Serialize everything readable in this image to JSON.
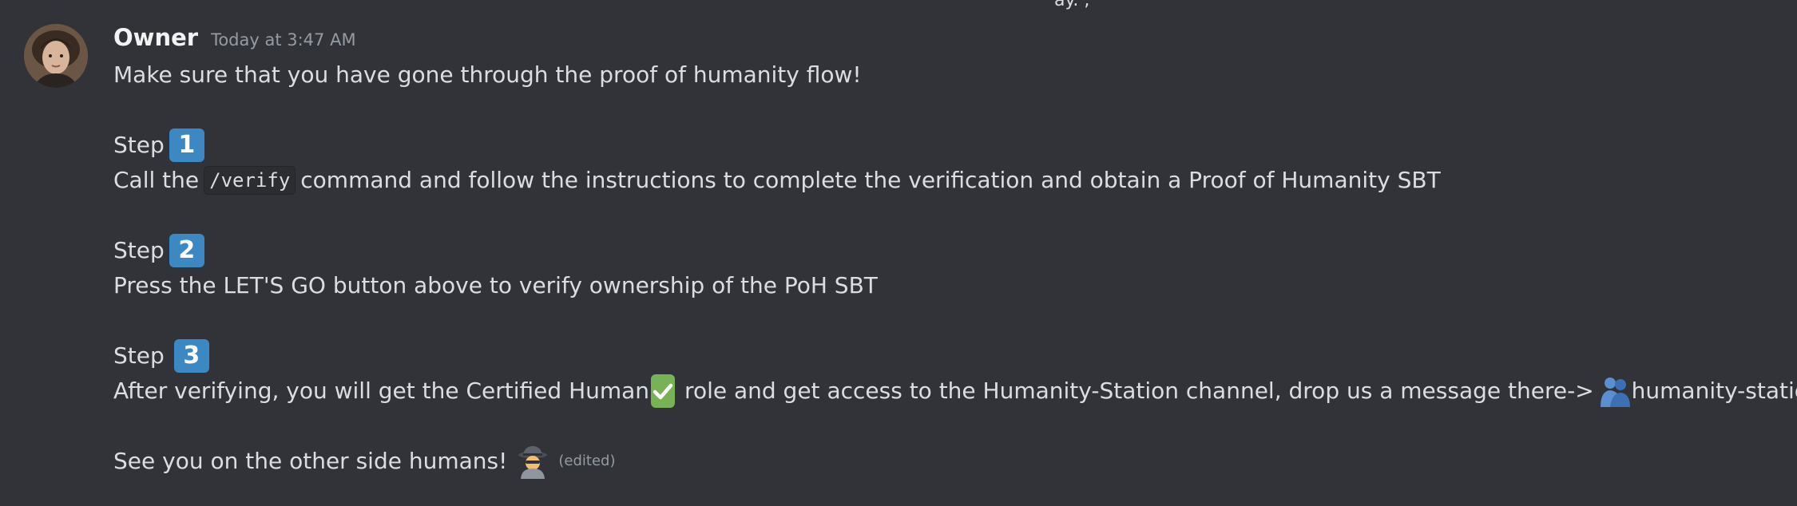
{
  "top_partial_text": "ay. ,",
  "message": {
    "username": "Owner",
    "timestamp": "Today at 3:47 AM",
    "intro": "Make sure that you have gone through the proof of humanity flow!",
    "steps": [
      {
        "label": "Step",
        "number": "1",
        "text_before": "Call the",
        "code": "/verify",
        "text_after": "command and follow the instructions to complete the verification and obtain a Proof of Humanity SBT"
      },
      {
        "label": "Step",
        "number": "2",
        "text": "Press the LET'S GO button above  to verify ownership of the PoH SBT"
      },
      {
        "label": "Step",
        "number": "3",
        "text_before": "After verifying, you will get the Certified Human",
        "text_after": "role and get access to the Humanity-Station channel, drop us a message there->",
        "channel": "humanity-station"
      }
    ],
    "closing": "See you on the other side humans!",
    "edited_label": "(edited)"
  },
  "icons": {
    "avatar": "avatar-portrait",
    "step_number": "keycap-digit-icon",
    "check": "check-mark-button-icon",
    "channel": "people-hugging-icon",
    "closing": "detective-icon"
  },
  "colors": {
    "background": "#313338",
    "text": "#dbdee1",
    "username": "#f2f3f5",
    "muted": "#949ba4",
    "keycap": "#3b88c3",
    "check": "#77b255"
  }
}
